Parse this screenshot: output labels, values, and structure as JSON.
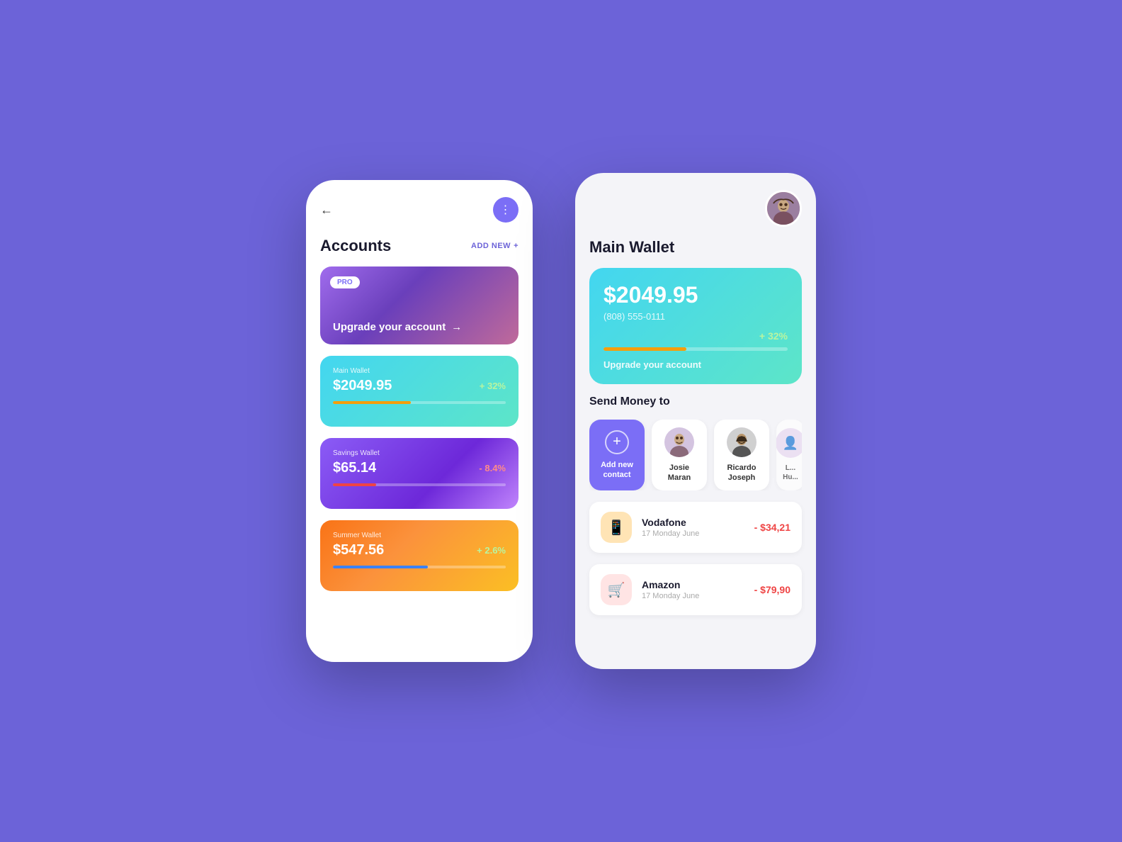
{
  "background": "#6c63d8",
  "left_phone": {
    "back_label": "←",
    "dots_label": "⋮",
    "section_title": "Accounts",
    "add_new_label": "ADD NEW",
    "pro_card": {
      "badge": "PRO",
      "upgrade_text": "Upgrade your account",
      "arrow": "→"
    },
    "main_wallet_card": {
      "label": "Main Wallet",
      "amount": "$2049.95",
      "percent": "+ 32%",
      "progress": 45
    },
    "savings_card": {
      "label": "Savings Wallet",
      "amount": "$65.14",
      "percent": "- 8.4%",
      "progress": 25
    },
    "summer_card": {
      "label": "Summer Wallet",
      "amount": "$547.56",
      "percent": "+ 2.6%",
      "progress": 55
    }
  },
  "right_phone": {
    "title": "Main Wallet",
    "wallet_card": {
      "amount": "$2049.95",
      "phone": "(808) 555-0111",
      "percent": "+ 32%",
      "progress": 45,
      "upgrade_text": "Upgrade your account"
    },
    "send_money": {
      "title": "Send Money to",
      "contacts": [
        {
          "id": "add",
          "label": "Add new\ncontact",
          "type": "add"
        },
        {
          "id": "josie",
          "label": "Josie\nMaran",
          "type": "person",
          "emoji": "👩"
        },
        {
          "id": "ricardo",
          "label": "Ricardo\nJoseph",
          "type": "person",
          "emoji": "🧔"
        },
        {
          "id": "partial",
          "label": "L...\nHu...",
          "type": "person",
          "emoji": "👤"
        }
      ]
    },
    "transactions": [
      {
        "id": "vodafone",
        "name": "Vodafone",
        "date": "17 Monday June",
        "amount": "- $34,21",
        "icon": "📱",
        "icon_class": "tx-icon-vodafone"
      },
      {
        "id": "amazon",
        "name": "Amazon",
        "date": "17 Monday June",
        "amount": "- $79,90",
        "icon": "🛒",
        "icon_class": "tx-icon-amazon"
      }
    ]
  }
}
